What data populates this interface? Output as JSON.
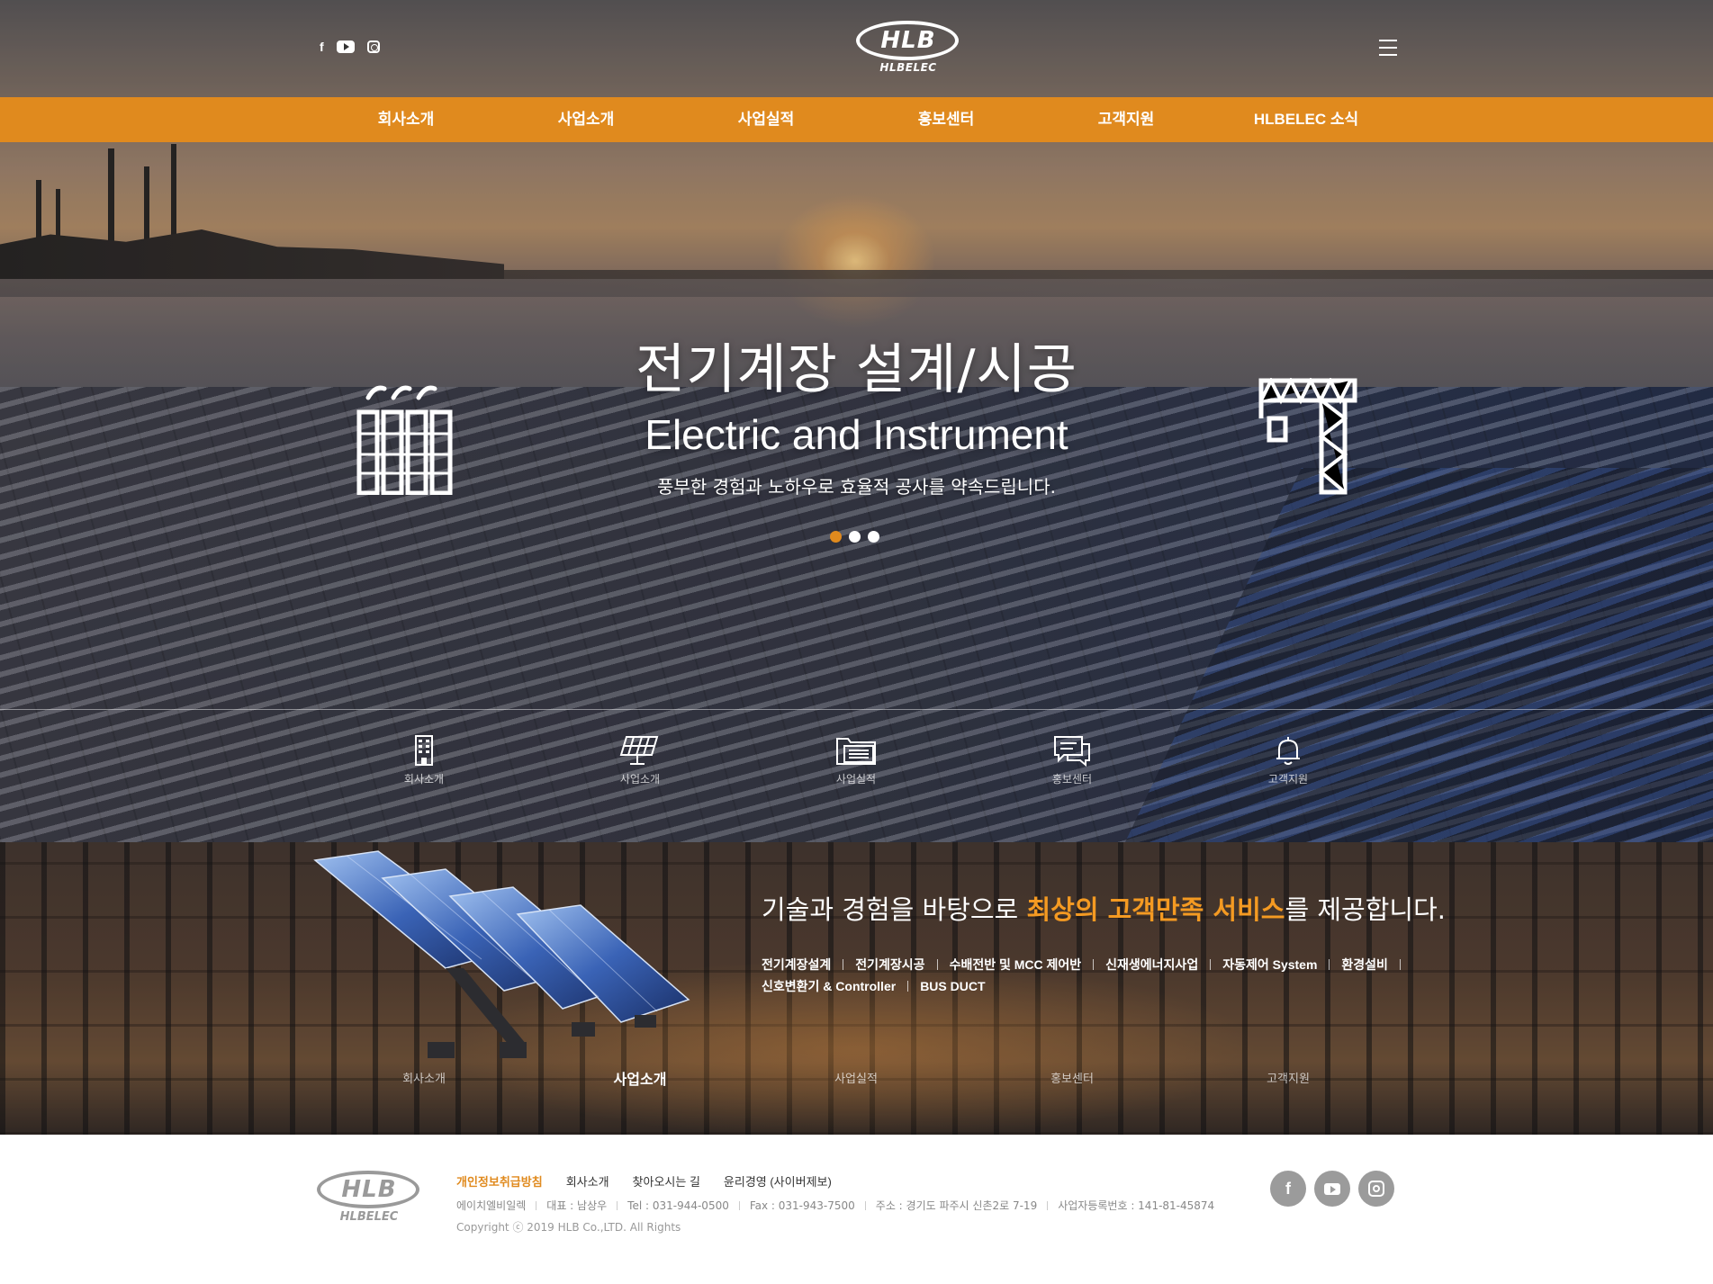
{
  "brand": {
    "logo_text": "HLB",
    "logo_sub": "HLBELEC",
    "accent_color": "#e08a1e",
    "highlight_color": "#f49a22"
  },
  "header": {
    "social": [
      {
        "icon": "facebook-icon",
        "glyph": "f"
      },
      {
        "icon": "youtube-icon"
      },
      {
        "icon": "instagram-icon"
      }
    ],
    "menu_icon": "hamburger-icon"
  },
  "nav": {
    "items": [
      "회사소개",
      "사업소개",
      "사업실적",
      "홍보센터",
      "고객지원",
      "HLBELEC 소식"
    ]
  },
  "hero": {
    "title": "전기계장 설계/시공",
    "subtitle": "Electric and Instrument",
    "description": "풍부한 경험과 노하우로 효율적 공사를 약속드립니다.",
    "slides": 3,
    "active_slide": 1,
    "left_icon": "factory-icon",
    "right_icon": "crane-icon"
  },
  "quick_menu": [
    {
      "label": "회사소개",
      "icon": "building-icon"
    },
    {
      "label": "사업소개",
      "icon": "solar-panel-icon"
    },
    {
      "label": "사업실적",
      "icon": "folder-list-icon"
    },
    {
      "label": "홍보센터",
      "icon": "chat-bubbles-icon"
    },
    {
      "label": "고객지원",
      "icon": "bell-icon"
    }
  ],
  "business": {
    "title_before": "기술과 경험을 바탕으로 ",
    "title_highlight": "최상의 고객만족 서비스",
    "title_after": "를 제공합니다.",
    "tags_row1": [
      "전기계장설계",
      "전기계장시공",
      "수배전반 및 MCC 제어반",
      "신재생에너지사업",
      "자동제어 System",
      "환경설비"
    ],
    "tags_row2": [
      "신호변환기 & Controller",
      "BUS DUCT"
    ],
    "menu": [
      "회사소개",
      "사업소개",
      "사업실적",
      "홍보센터",
      "고객지원"
    ],
    "active_menu": "사업소개"
  },
  "footer": {
    "links": [
      "개인정보취급방침",
      "회사소개",
      "찾아오시는 길",
      "윤리경영 (사이버제보)"
    ],
    "info": [
      "에이치엘비일렉",
      "대표 : 남상우",
      "Tel : 031-944-0500",
      "Fax : 031-943-7500",
      "주소 : 경기도 파주시 신촌2로 7-19",
      "사업자등록번호 : 141-81-45874"
    ],
    "copyright": "Copyright ⓒ 2019 HLB Co.,LTD. All Rights",
    "social": [
      {
        "icon": "facebook-icon",
        "glyph": "f"
      },
      {
        "icon": "youtube-icon"
      },
      {
        "icon": "instagram-icon"
      }
    ]
  }
}
